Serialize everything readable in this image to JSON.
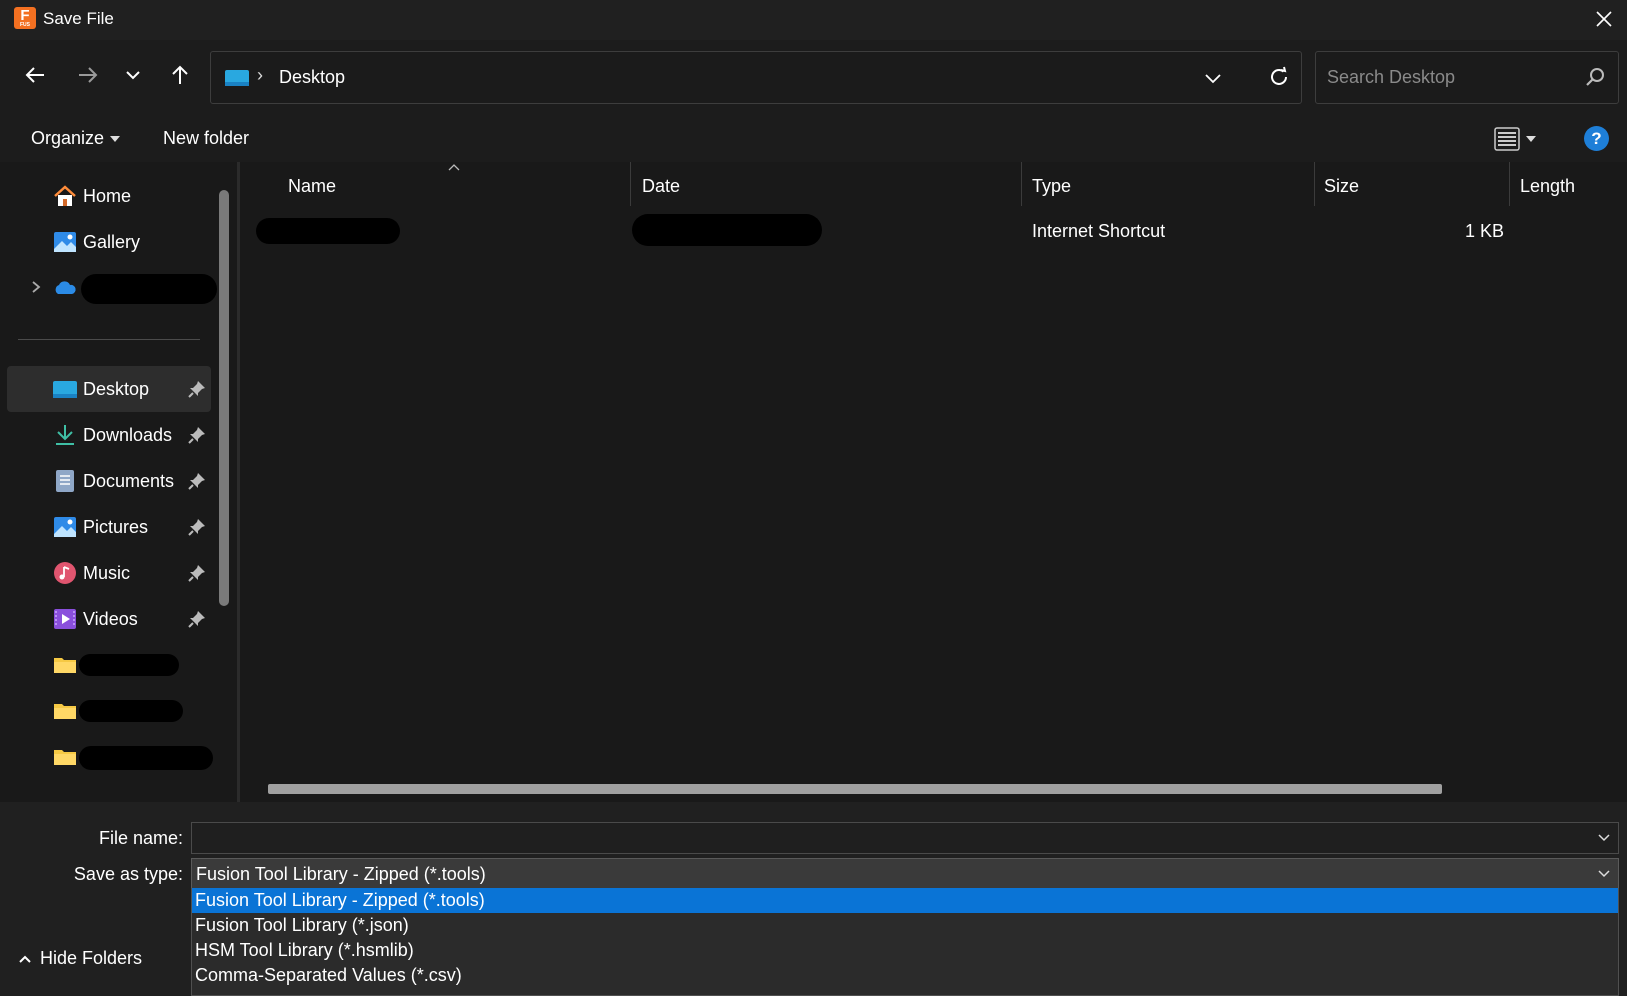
{
  "window": {
    "title": "Save File",
    "app_icon_letter": "F",
    "app_icon_sub": "FUS"
  },
  "address": {
    "path": "Desktop",
    "separator": "›"
  },
  "search": {
    "placeholder": "Search Desktop"
  },
  "commands": {
    "organize": "Organize",
    "new_folder": "New folder",
    "help": "?"
  },
  "sidebar": {
    "items": [
      {
        "label": "Home"
      },
      {
        "label": "Gallery"
      },
      {
        "label": "Desktop"
      },
      {
        "label": "Downloads"
      },
      {
        "label": "Documents"
      },
      {
        "label": "Pictures"
      },
      {
        "label": "Music"
      },
      {
        "label": "Videos"
      }
    ]
  },
  "file_list": {
    "columns": [
      "Name",
      "Date",
      "Type",
      "Size",
      "Length"
    ],
    "rows": [
      {
        "type": "Internet Shortcut",
        "size": "1 KB"
      }
    ]
  },
  "save": {
    "file_name_label": "File name:",
    "file_name_value": "",
    "save_type_label": "Save as type:",
    "save_type_value": "Fusion Tool Library - Zipped (*.tools)",
    "type_options": [
      "Fusion Tool Library - Zipped (*.tools)",
      "Fusion Tool Library (*.json)",
      "HSM Tool Library (*.hsmlib)",
      "Comma-Separated Values (*.csv)"
    ],
    "hide_folders": "Hide Folders"
  },
  "colors": {
    "accent": "#0a74d6",
    "background": "#191919",
    "app_icon": "#f37021"
  }
}
